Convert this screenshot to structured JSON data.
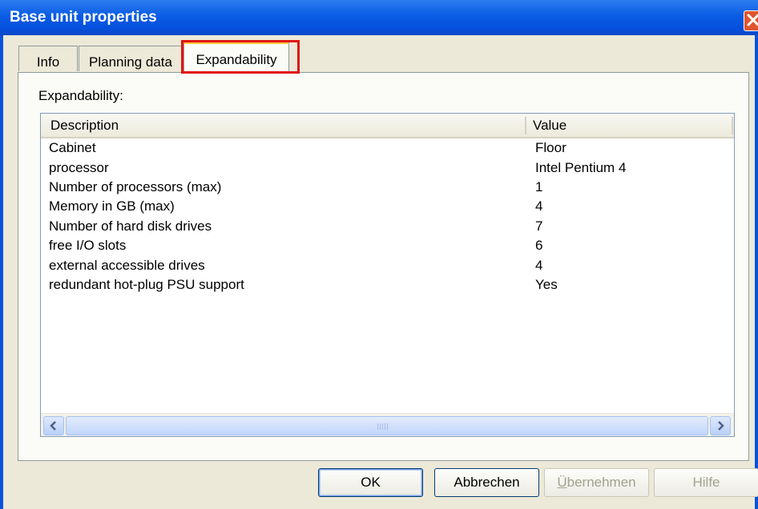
{
  "window": {
    "title": "Base unit properties"
  },
  "tabs": [
    {
      "label": "Info",
      "selected": false
    },
    {
      "label": "Planning data",
      "selected": false
    },
    {
      "label": "Expandability",
      "selected": true,
      "highlighted": true
    }
  ],
  "section": {
    "label": "Expandability:"
  },
  "list": {
    "columns": [
      "Description",
      "Value"
    ],
    "rows": [
      {
        "description": "Cabinet",
        "value": "Floor"
      },
      {
        "description": "processor",
        "value": "Intel Pentium 4"
      },
      {
        "description": "Number of processors (max)",
        "value": "1"
      },
      {
        "description": "Memory in GB (max)",
        "value": "4"
      },
      {
        "description": "Number of hard disk drives",
        "value": "7"
      },
      {
        "description": "free I/O slots",
        "value": "6"
      },
      {
        "description": "external accessible drives",
        "value": "4"
      },
      {
        "description": "redundant hot-plug PSU support",
        "value": "Yes"
      }
    ]
  },
  "buttons": {
    "ok": "OK",
    "cancel": "Abbrechen",
    "apply_first": "Ü",
    "apply_rest": "bernehmen",
    "help": "Hilfe"
  },
  "colors": {
    "titlebar": "#0a5ce4",
    "highlight": "#e01414",
    "dialog_bg": "#ece9d8"
  }
}
